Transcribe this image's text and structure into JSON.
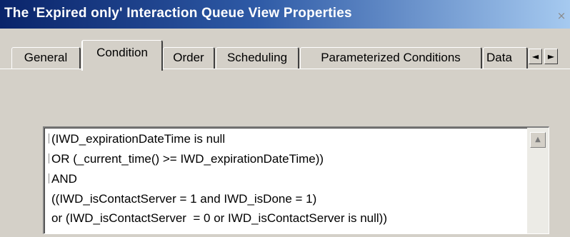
{
  "window": {
    "title": "The 'Expired only' Interaction Queue View Properties",
    "close_glyph": "×"
  },
  "tabs": [
    {
      "label": "General",
      "active": false
    },
    {
      "label": "Condition",
      "active": true
    },
    {
      "label": "Order",
      "active": false
    },
    {
      "label": "Scheduling",
      "active": false
    },
    {
      "label": "Parameterized Conditions",
      "active": false
    },
    {
      "label": "Data",
      "active": false
    }
  ],
  "tab_scroll": {
    "left_glyph": "◄",
    "right_glyph": "►"
  },
  "condition": {
    "lines": [
      "(IWD_expirationDateTime is null",
      "OR (_current_time() >= IWD_expirationDateTime))",
      "AND",
      "((IWD_isContactServer = 1 and IWD_isDone = 1)",
      "or (IWD_isContactServer  = 0 or IWD_isContactServer is null))"
    ],
    "scroll_up_glyph": "▲"
  },
  "colors": {
    "titlebar_start": "#0a246a",
    "titlebar_end": "#a6caf0",
    "dialog_face": "#d4d0c8"
  }
}
